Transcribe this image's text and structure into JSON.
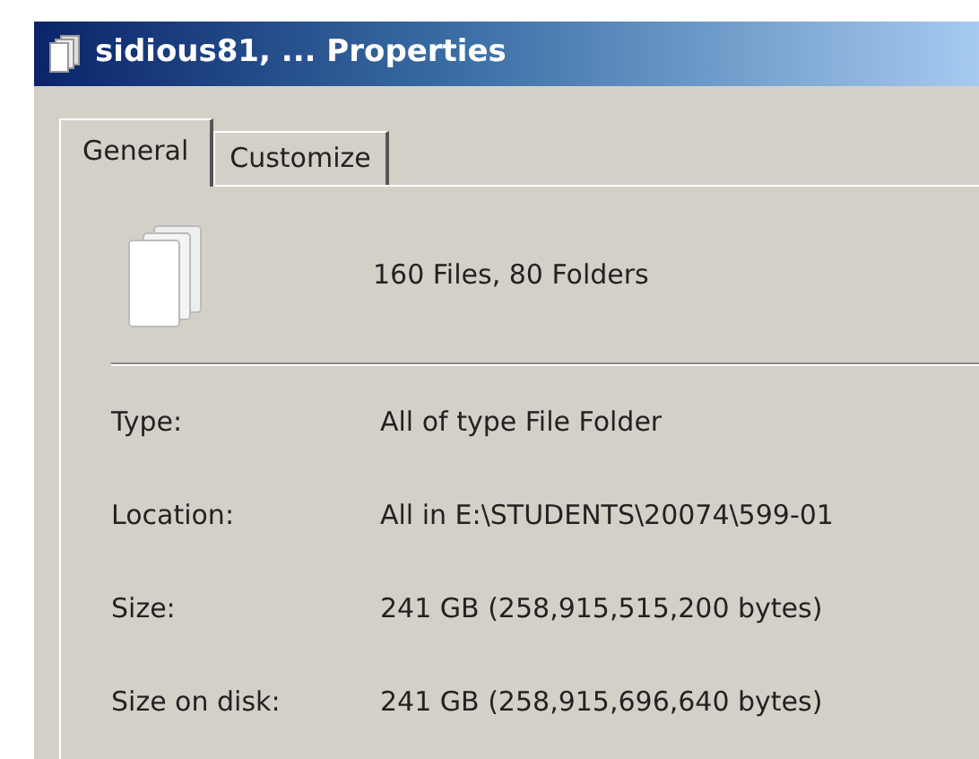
{
  "window": {
    "title": "sidious81, ... Properties"
  },
  "tabs": [
    {
      "label": "General",
      "selected": true
    },
    {
      "label": "Customize",
      "selected": false
    }
  ],
  "summary": "160 Files, 80 Folders",
  "properties": [
    {
      "label": "Type:",
      "value": "All of type File Folder"
    },
    {
      "label": "Location:",
      "value": "All in E:\\STUDENTS\\20074\\599-01"
    },
    {
      "label": "Size:",
      "value": "241 GB (258,915,515,200 bytes)"
    },
    {
      "label": "Size on disk:",
      "value": "241 GB (258,915,696,640 bytes)"
    }
  ]
}
